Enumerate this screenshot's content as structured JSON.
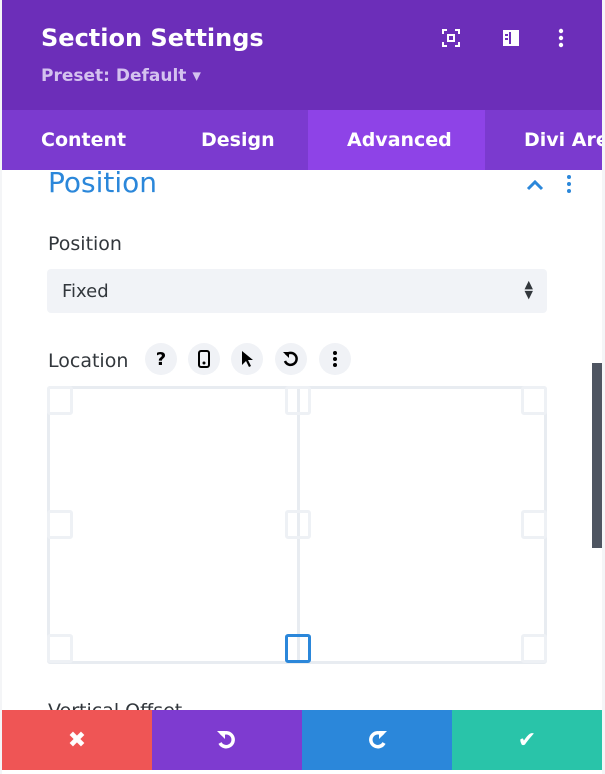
{
  "header": {
    "title": "Section Settings",
    "preset": "Preset: Default ▾",
    "icons": [
      "focus-icon",
      "sidebar-toggle-icon",
      "more-vertical-icon"
    ]
  },
  "tabs": [
    {
      "label": "Content",
      "active": false
    },
    {
      "label": "Design",
      "active": false
    },
    {
      "label": "Advanced",
      "active": true
    },
    {
      "label": "Divi Are",
      "active": false
    }
  ],
  "section": {
    "title": "Position",
    "position_label": "Position",
    "position_value": "Fixed",
    "location_label": "Location",
    "location_buttons": [
      "help-icon",
      "mobile-icon",
      "cursor-icon",
      "reset-icon",
      "more-vertical-icon"
    ],
    "location_selected": "bottom-center",
    "next_label": "Vertical Offset"
  },
  "footer": {
    "buttons": [
      {
        "name": "cancel",
        "color": "#ef5555"
      },
      {
        "name": "undo",
        "color": "#7e3bd0"
      },
      {
        "name": "redo",
        "color": "#2b87da"
      },
      {
        "name": "save",
        "color": "#29c4a9"
      }
    ]
  }
}
